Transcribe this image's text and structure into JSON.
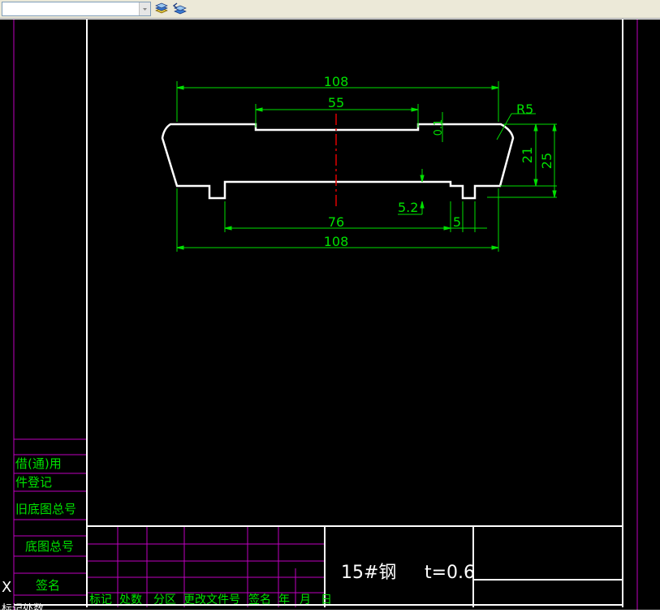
{
  "toolbar": {
    "layer_combo_value": "",
    "icons": [
      "layer-properties-icon",
      "layer-previous-icon"
    ]
  },
  "colors": {
    "canvas": "#000000",
    "outline": "#ffffff",
    "dimension": "#00e000",
    "border_frame": "#c000c0",
    "centerline": "#e00000"
  },
  "drawing": {
    "dims": {
      "top_width": "108",
      "slot_width": "55",
      "slot_depth": "0.1",
      "corner_radius": "R5",
      "height_21": "21",
      "height_25": "25",
      "step_height": "5.2",
      "inner_width": "76",
      "foot_width": "5",
      "bottom_width": "108"
    }
  },
  "title_block": {
    "left_labels": [
      "借(通)用",
      "件登记",
      "旧底图总号",
      "底图总号",
      "签名"
    ],
    "revision_headers": [
      "标记",
      "处数",
      "分区",
      "更改文件号",
      "签名",
      "年",
      "月",
      "日"
    ],
    "material": "15#钢",
    "thickness": "t=0.6",
    "edge_marks": [
      "X",
      "标记处数"
    ]
  }
}
